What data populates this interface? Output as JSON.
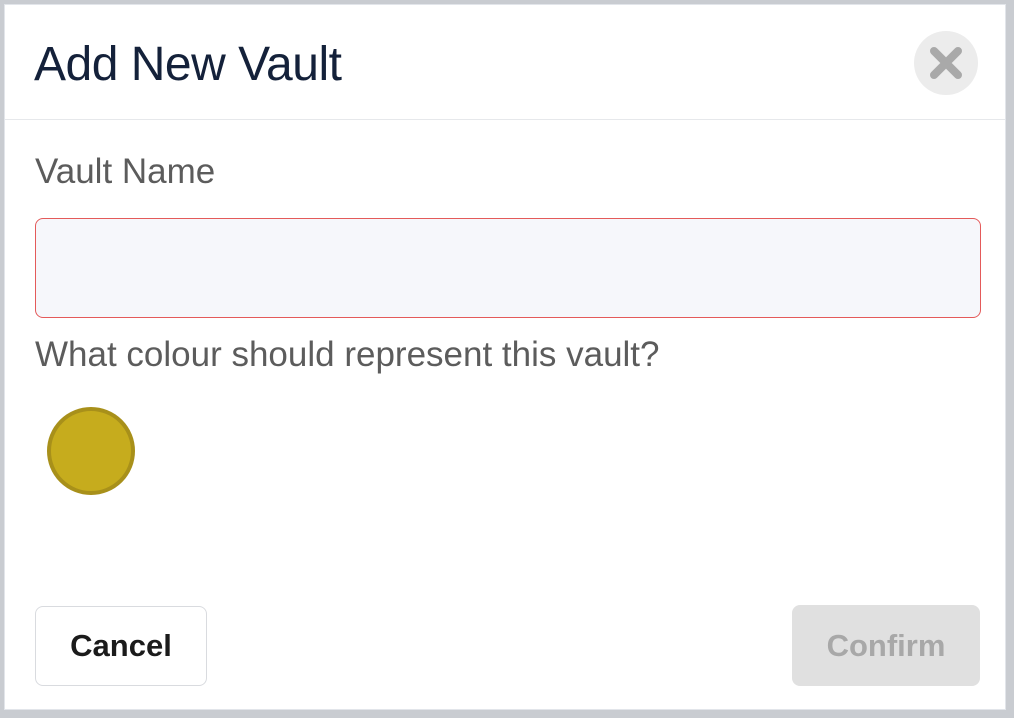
{
  "dialog": {
    "title": "Add New Vault",
    "close_icon": "close-icon"
  },
  "form": {
    "vault_name": {
      "label": "Vault Name",
      "value": "",
      "placeholder": ""
    },
    "colour": {
      "label": "What colour should represent this vault?",
      "selected_colour": "#c6ac1d",
      "selected_border": "#a8901a"
    }
  },
  "actions": {
    "cancel_label": "Cancel",
    "confirm_label": "Confirm",
    "confirm_disabled": true
  },
  "colors": {
    "error_border": "#e45a5a",
    "title_text": "#14213a"
  }
}
